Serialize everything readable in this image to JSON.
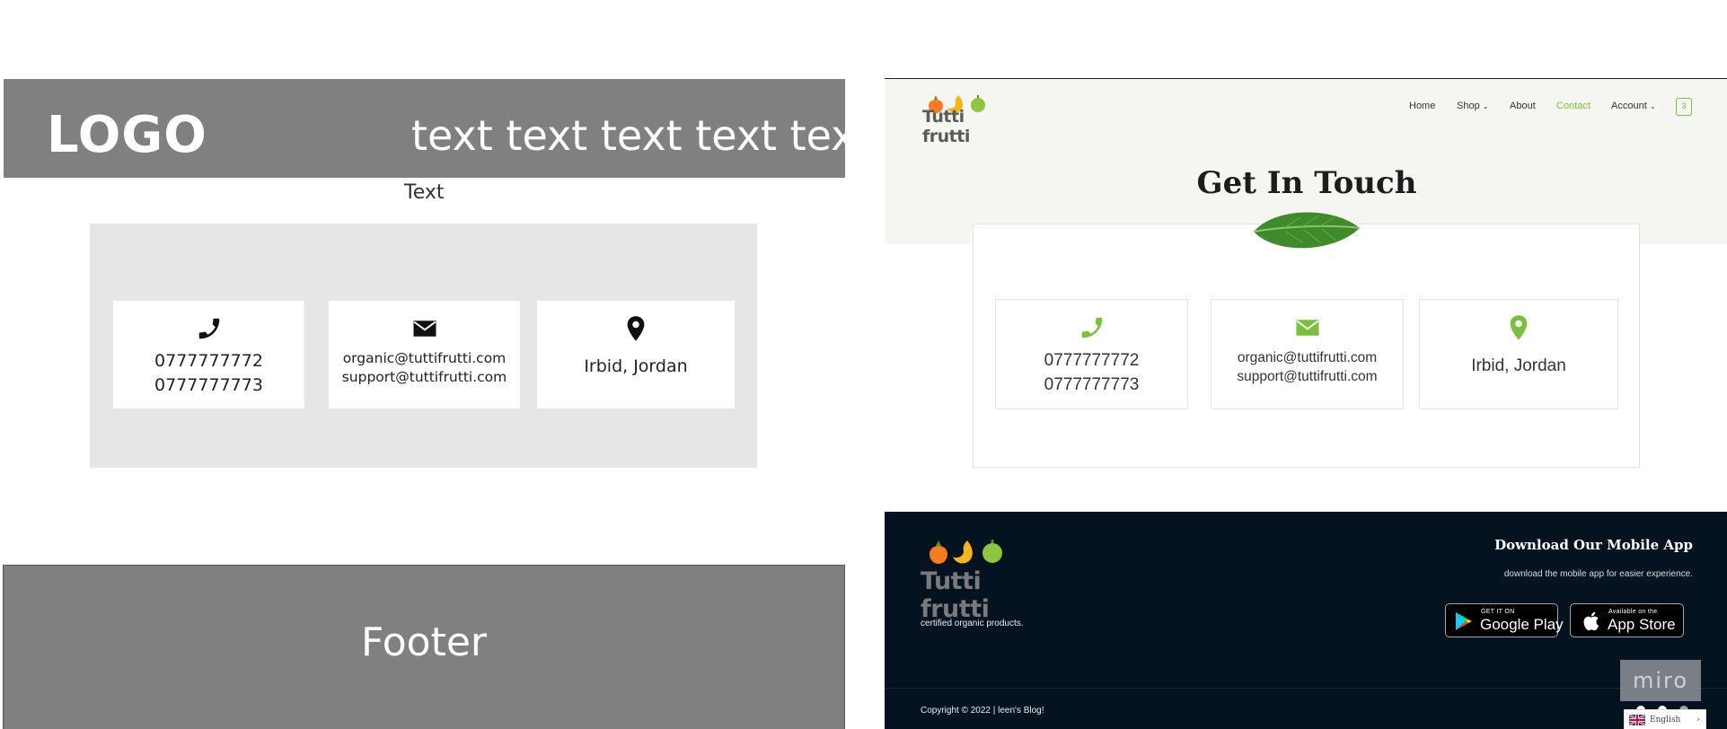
{
  "wireframe": {
    "logo": "LOGO",
    "nav_text": "text text  text text text",
    "subtitle": "Text",
    "footer_label": "Footer",
    "cards": [
      {
        "icon": "phone-icon",
        "lines": [
          "0777777772",
          "0777777773"
        ]
      },
      {
        "icon": "envelope-icon",
        "lines": [
          "organic@tuttifrutti.com",
          "support@tuttifrutti.com"
        ]
      },
      {
        "icon": "map-pin-icon",
        "lines": [
          "Irbid, Jordan"
        ]
      }
    ]
  },
  "design": {
    "brand": "Tutti frutti",
    "nav": {
      "home": "Home",
      "shop": "Shop",
      "about": "About",
      "contact": "Contact",
      "account": "Account",
      "cart_count": "3"
    },
    "title": "Get In Touch",
    "cards": [
      {
        "icon": "phone-icon",
        "lines": [
          "0777777772",
          "0777777773"
        ]
      },
      {
        "icon": "envelope-icon",
        "lines": [
          "organic@tuttifrutti.com",
          "support@tuttifrutti.com"
        ]
      },
      {
        "icon": "map-pin-icon",
        "lines": [
          "Irbid, Jordan"
        ]
      }
    ],
    "footer": {
      "brand": "Tutti frutti",
      "certified": "certified organic products.",
      "download_title": "Download Our Mobile App",
      "download_sub": "download the mobile app for easier experience.",
      "google_small": "GET IT ON",
      "google_big": "Google Play",
      "apple_small": "Available on the",
      "apple_big": "App Store",
      "copyright": "Copyright © 2022 | leen's Blog!",
      "language": "English"
    },
    "overlay": "miro",
    "colors": {
      "accent_green": "#7bbf3e",
      "footer_bg": "#04131f",
      "header_bg": "#f5f5f2",
      "wireframe_gray": "#808080"
    }
  }
}
